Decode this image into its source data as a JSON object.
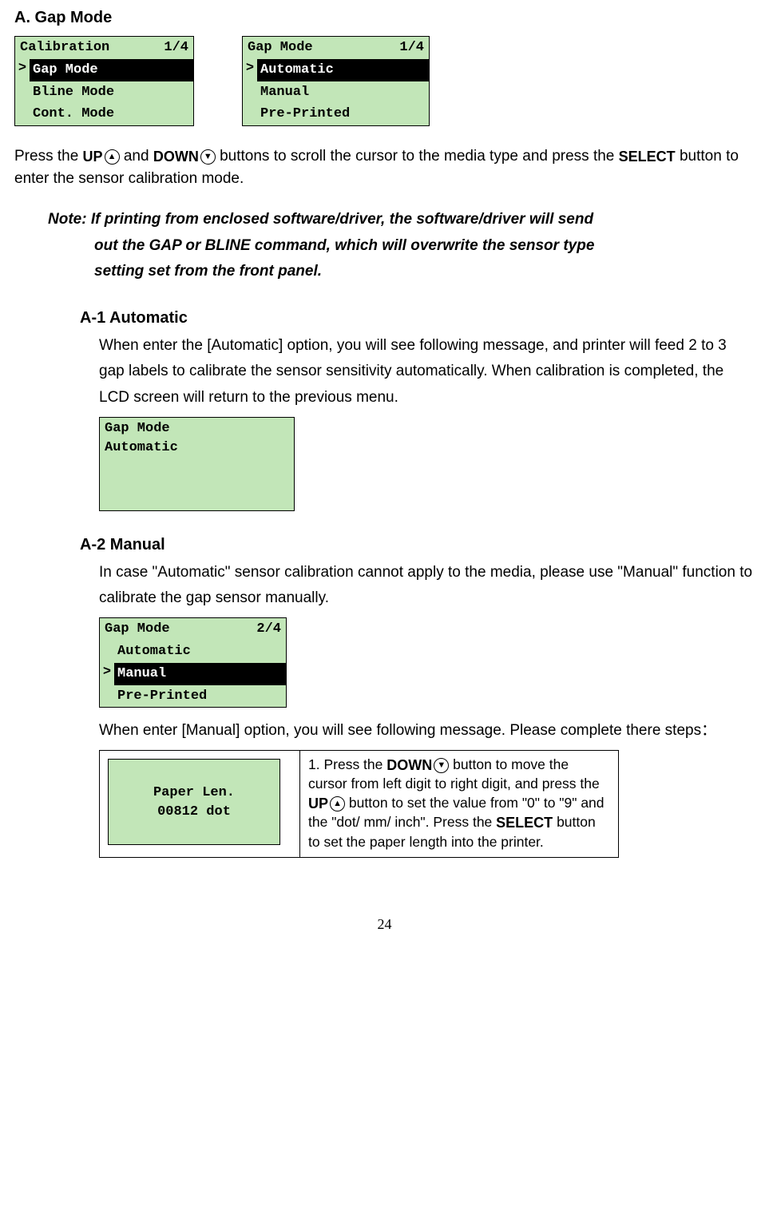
{
  "headingA": "A. Gap Mode",
  "lcd1": {
    "titleLeft": "Calibration",
    "titleRight": "1/4",
    "rows": [
      {
        "cursor": ">",
        "label": "Gap Mode",
        "selected": true
      },
      {
        "cursor": "",
        "label": "Bline Mode",
        "selected": false
      },
      {
        "cursor": "",
        "label": "Cont. Mode",
        "selected": false
      }
    ]
  },
  "lcd2": {
    "titleLeft": "Gap Mode",
    "titleRight": "1/4",
    "rows": [
      {
        "cursor": ">",
        "label": "Automatic",
        "selected": true
      },
      {
        "cursor": "",
        "label": "Manual",
        "selected": false
      },
      {
        "cursor": "",
        "label": "Pre-Printed",
        "selected": false
      }
    ]
  },
  "para1_a": "Press the",
  "btnUP": "UP",
  "para1_b": "and",
  "btnDOWN": "DOWN",
  "para1_c": "buttons to scroll the cursor to the media type and press the",
  "btnSELECT": "SELECT",
  "para1_d": "button to enter the sensor calibration mode.",
  "noteLead": "Note: ",
  "noteText1": "If printing from enclosed software/driver, the software/driver will send",
  "noteText2": "out the GAP or BLINE command, which will overwrite the sensor type",
  "noteText3": "setting set from the front panel.",
  "a1": {
    "heading": "A-1 Automatic",
    "body": "When enter the [Automatic] option, you will see following message, and printer will feed 2 to 3 gap labels to calibrate the sensor sensitivity automatically. When calibration is completed, the LCD screen will return to the previous menu.",
    "lcdLine1": "Gap Mode",
    "lcdLine2": "Automatic"
  },
  "a2": {
    "heading": "A-2 Manual",
    "body1": "In case \"Automatic\" sensor calibration cannot apply to the media, please use \"Manual\" function to calibrate the gap sensor manually.",
    "lcd": {
      "titleLeft": "Gap Mode",
      "titleRight": "2/4",
      "rows": [
        {
          "cursor": "",
          "label": "Automatic",
          "selected": false
        },
        {
          "cursor": ">",
          "label": "Manual",
          "selected": true
        },
        {
          "cursor": "",
          "label": "Pre-Printed",
          "selected": false
        }
      ]
    },
    "body2": "When enter [Manual] option, you will see following message. Please complete there steps：",
    "paperLen1": "Paper Len.",
    "paperLen2": "00812 dot",
    "step1_a": "1. Press the",
    "step1_b_down": "DOWN",
    "step1_c": "button to move the cursor from left digit to right digit, and press the",
    "step1_d_up": "UP",
    "step1_e": "button to set the value from \"0\" to \"9\" and the \"dot/ mm/ inch\". Press the",
    "step1_f_select": "SELECT",
    "step1_g": "button to set the paper length into the printer."
  },
  "pageNumber": "24"
}
